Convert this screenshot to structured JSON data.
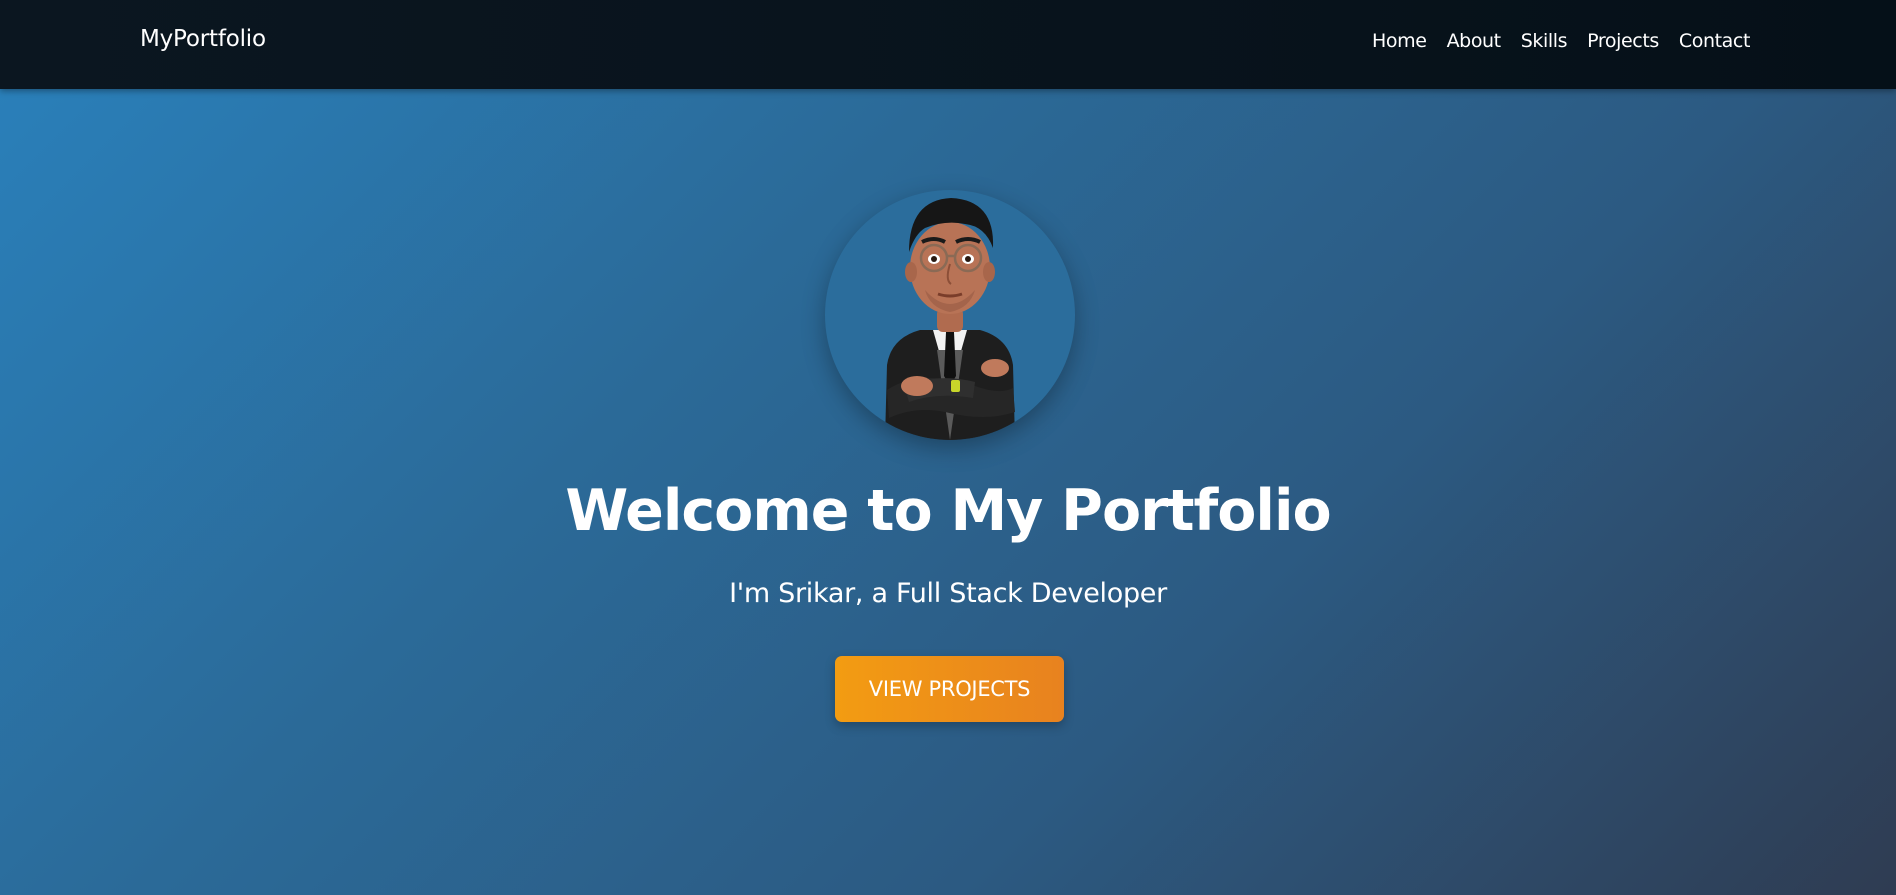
{
  "navbar": {
    "brand": "MyPortfolio",
    "links": [
      {
        "label": "Home"
      },
      {
        "label": "About"
      },
      {
        "label": "Skills"
      },
      {
        "label": "Projects"
      },
      {
        "label": "Contact"
      }
    ]
  },
  "hero": {
    "avatar_icon": "memoji-avatar-icon",
    "title": "Welcome to My Portfolio",
    "subtitle": "I'm Srikar, a Full Stack Developer",
    "cta_label": "VIEW PROJECTS"
  },
  "colors": {
    "navbar_bg": "#08131c",
    "hero_gradient_start": "#2a7fb9",
    "hero_gradient_end": "#2f3c52",
    "accent": "#f39c12"
  }
}
